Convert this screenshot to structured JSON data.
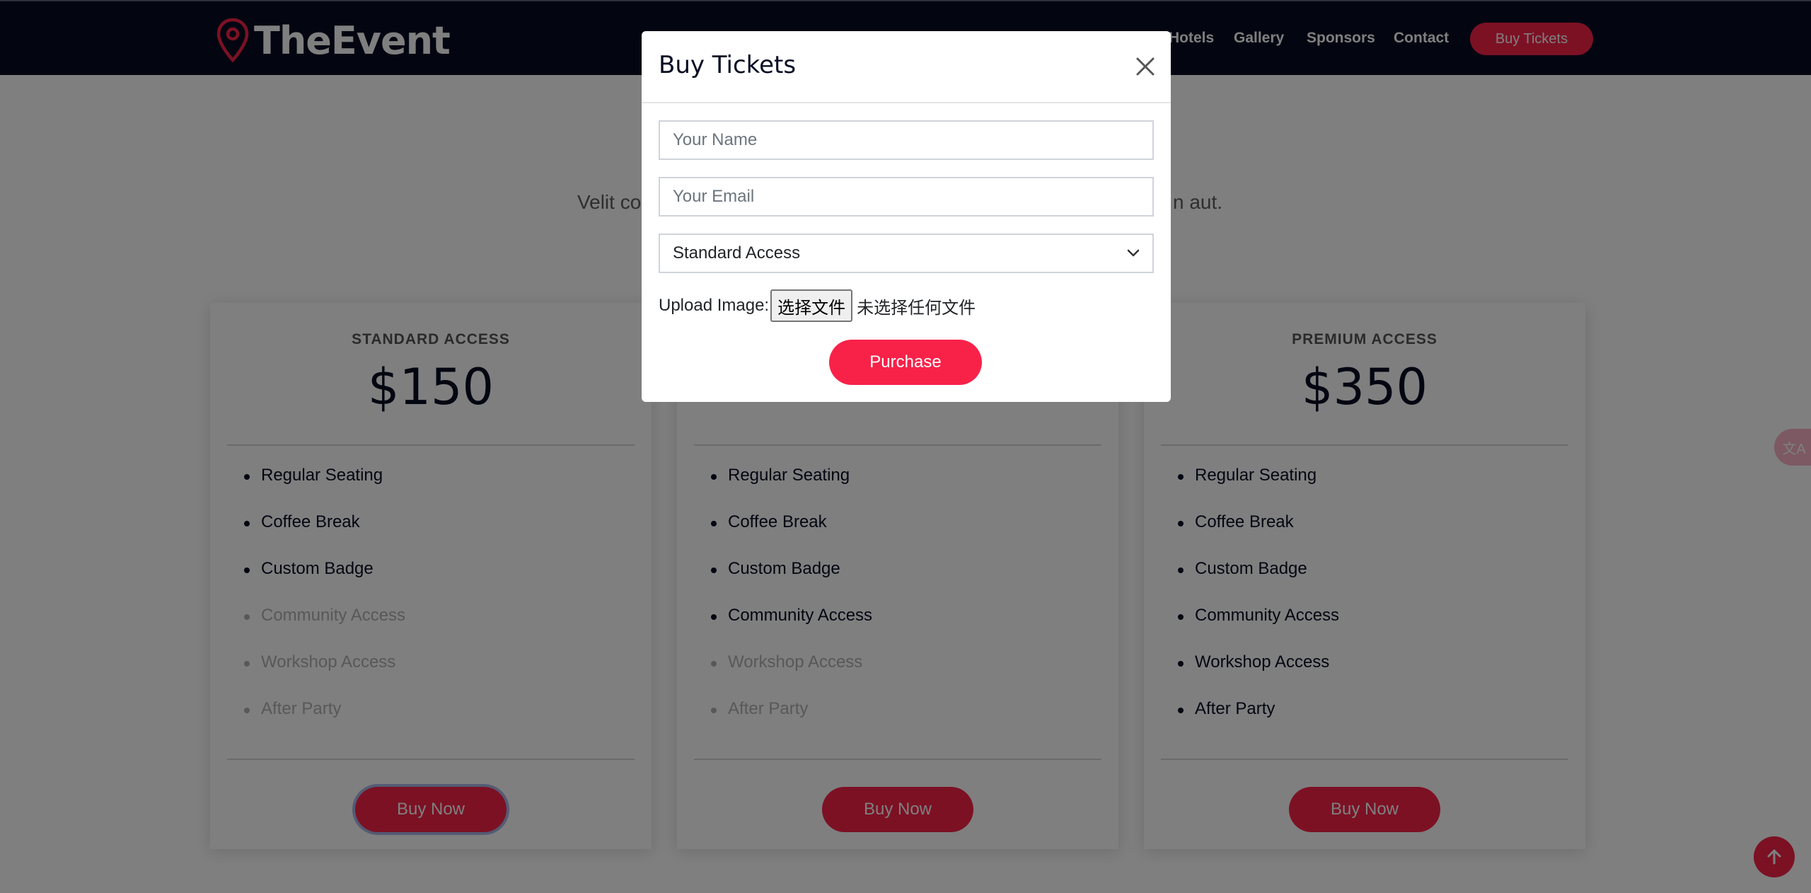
{
  "header": {
    "logo_text": "TheEvent",
    "nav": [
      "Hotels",
      "Gallery",
      "Sponsors",
      "Contact"
    ],
    "cta_label": "Buy Tickets"
  },
  "section": {
    "subtitle_left": "Velit co",
    "subtitle_right": "n aut."
  },
  "cards": [
    {
      "title": "STANDARD ACCESS",
      "price": "$150",
      "features": [
        {
          "label": "Regular Seating",
          "available": true
        },
        {
          "label": "Coffee Break",
          "available": true
        },
        {
          "label": "Custom Badge",
          "available": true
        },
        {
          "label": "Community Access",
          "available": false
        },
        {
          "label": "Workshop Access",
          "available": false
        },
        {
          "label": "After Party",
          "available": false
        }
      ],
      "button": "Buy Now"
    },
    {
      "title": "",
      "price": "",
      "features": [
        {
          "label": "Regular Seating",
          "available": true
        },
        {
          "label": "Coffee Break",
          "available": true
        },
        {
          "label": "Custom Badge",
          "available": true
        },
        {
          "label": "Community Access",
          "available": true
        },
        {
          "label": "Workshop Access",
          "available": false
        },
        {
          "label": "After Party",
          "available": false
        }
      ],
      "button": "Buy Now"
    },
    {
      "title": "PREMIUM ACCESS",
      "price": "$350",
      "features": [
        {
          "label": "Regular Seating",
          "available": true
        },
        {
          "label": "Coffee Break",
          "available": true
        },
        {
          "label": "Custom Badge",
          "available": true
        },
        {
          "label": "Community Access",
          "available": true
        },
        {
          "label": "Workshop Access",
          "available": true
        },
        {
          "label": "After Party",
          "available": true
        }
      ],
      "button": "Buy Now"
    }
  ],
  "modal": {
    "title": "Buy Tickets",
    "name_placeholder": "Your Name",
    "email_placeholder": "Your Email",
    "ticket_type_selected": "Standard Access",
    "upload_label": "Upload Image:",
    "file_button": "选择文件",
    "file_status": "未选择任何文件",
    "purchase_label": "Purchase"
  },
  "floating": {
    "translate_icon": "translate-icon",
    "back_to_top_icon": "arrow-up-icon"
  },
  "colors": {
    "accent": "#f82249",
    "dark": "#060c22"
  }
}
